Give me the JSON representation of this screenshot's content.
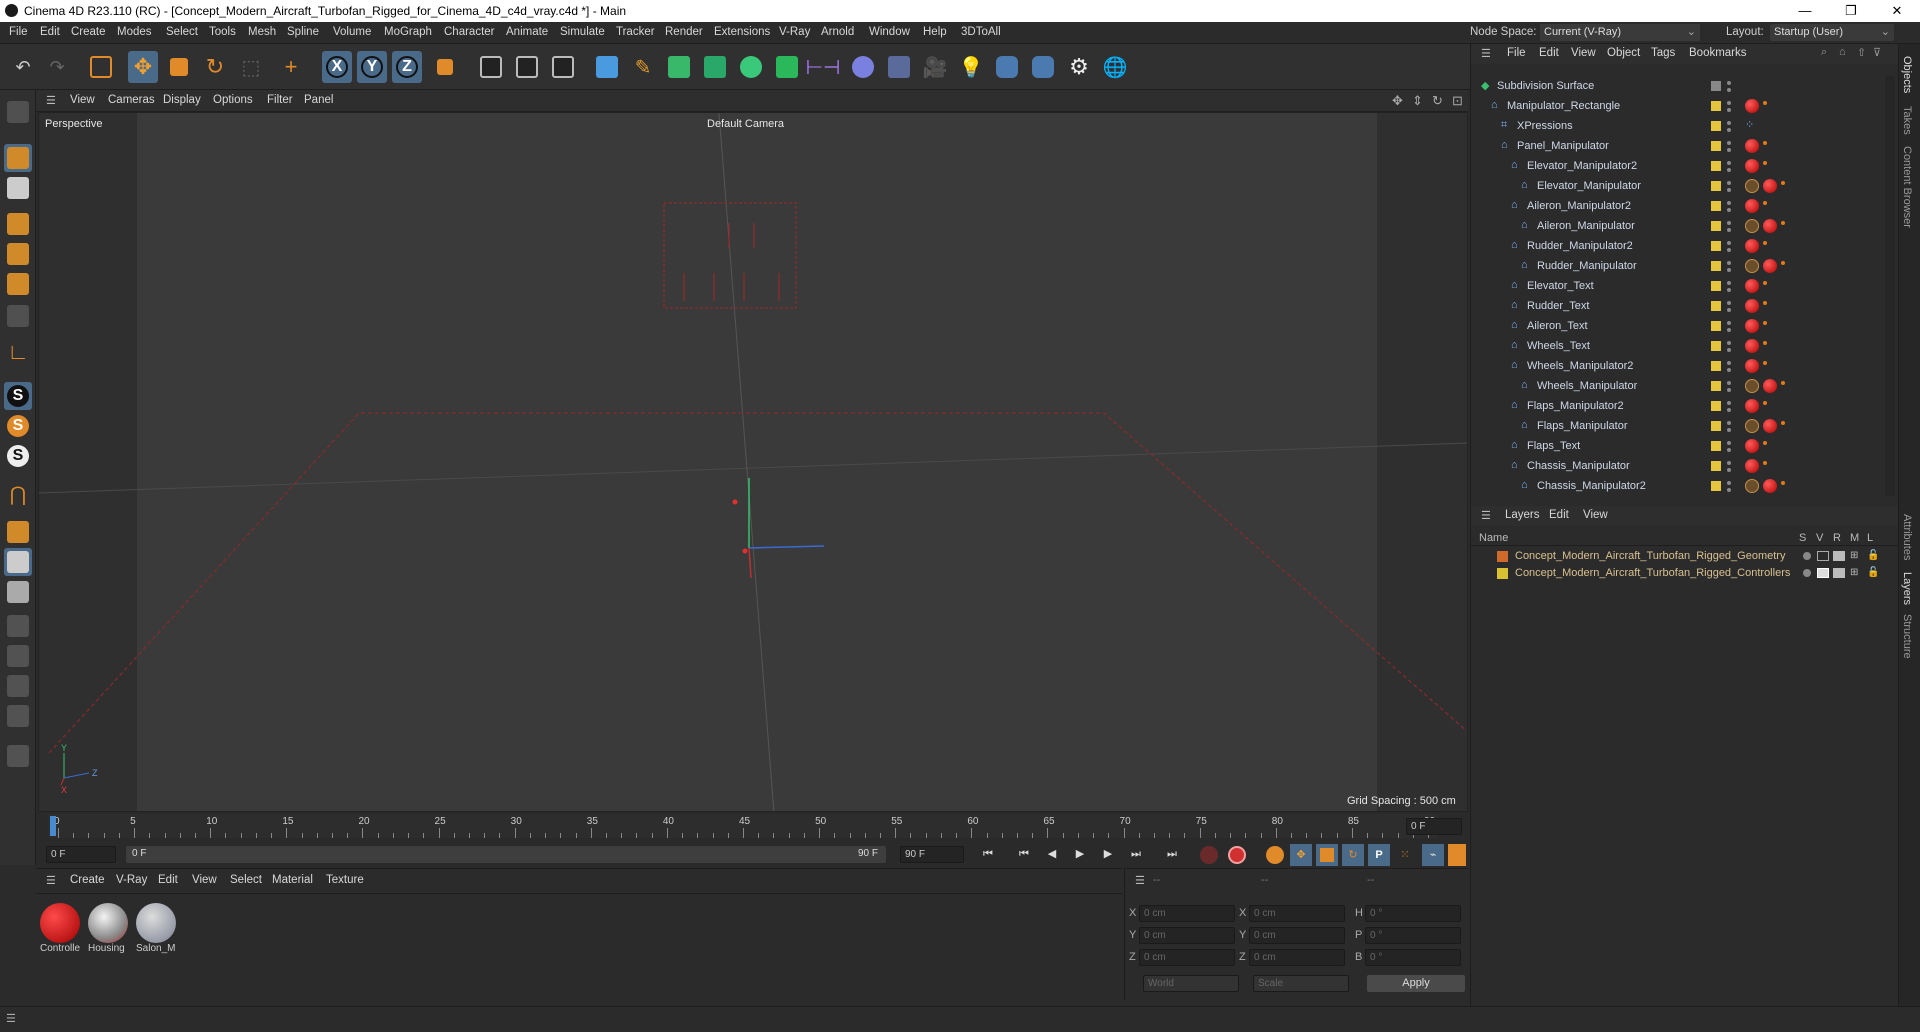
{
  "window": {
    "title": "Cinema 4D R23.110 (RC) - [Concept_Modern_Aircraft_Turbofan_Rigged_for_Cinema_4D_c4d_vray.c4d *] - Main",
    "min": "—",
    "max": "❐",
    "close": "✕"
  },
  "menu": [
    "File",
    "Edit",
    "Create",
    "Modes",
    "Select",
    "Tools",
    "Mesh",
    "Spline",
    "Volume",
    "MoGraph",
    "Character",
    "Animate",
    "Simulate",
    "Tracker",
    "Render",
    "Extensions",
    "V-Ray",
    "Arnold",
    "Window",
    "Help",
    "3DToAll"
  ],
  "nodespace": {
    "label": "Node Space:",
    "value": "Current (V-Ray)"
  },
  "layout": {
    "label": "Layout:",
    "value": "Startup (User)"
  },
  "viewport_menu": [
    "View",
    "Cameras",
    "Display",
    "Options",
    "Filter",
    "Panel"
  ],
  "viewport": {
    "name": "Perspective",
    "camera": "Default Camera",
    "grid_spacing": "Grid Spacing : 500 cm",
    "axis_y": "Y",
    "axis_z": "Z",
    "axis_x": "X"
  },
  "timeline": {
    "ticks": [
      "0",
      "5",
      "10",
      "15",
      "20",
      "25",
      "30",
      "35",
      "40",
      "45",
      "50",
      "55",
      "60",
      "65",
      "70",
      "75",
      "80",
      "85",
      "90"
    ],
    "current_frame_right": "0 F",
    "start_field": "0 F",
    "range_start": "0 F",
    "range_end": "90 F",
    "end_field": "90 F"
  },
  "materials": {
    "menu": [
      "Create",
      "V-Ray",
      "Edit",
      "View",
      "Select",
      "Material",
      "Texture"
    ],
    "items": [
      {
        "label": "Controlle"
      },
      {
        "label": "Housing"
      },
      {
        "label": "Salon_M"
      }
    ]
  },
  "coords": {
    "header": [
      "--",
      "--",
      "--"
    ],
    "rows": [
      {
        "a": "X",
        "av": "0 cm",
        "b": "X",
        "bv": "0 cm",
        "c": "H",
        "cv": "0 °"
      },
      {
        "a": "Y",
        "av": "0 cm",
        "b": "Y",
        "bv": "0 cm",
        "c": "P",
        "cv": "0 °"
      },
      {
        "a": "Z",
        "av": "0 cm",
        "b": "Z",
        "bv": "0 cm",
        "c": "B",
        "cv": "0 °"
      }
    ],
    "world": "World",
    "scale": "Scale",
    "apply": "Apply"
  },
  "objects": {
    "menu": [
      "File",
      "Edit",
      "View",
      "Object",
      "Tags",
      "Bookmarks"
    ],
    "items": [
      {
        "name": "Subdivision Surface",
        "depth": 0,
        "tags": "none"
      },
      {
        "name": "Manipulator_Rectangle",
        "depth": 1,
        "tags": "red"
      },
      {
        "name": "XPressions",
        "depth": 2,
        "tags": "xp"
      },
      {
        "name": "Panel_Manipulator",
        "depth": 2,
        "tags": "red"
      },
      {
        "name": "Elevator_Manipulator2",
        "depth": 3,
        "tags": "red"
      },
      {
        "name": "Elevator_Manipulator",
        "depth": 4,
        "tags": "slash"
      },
      {
        "name": "Aileron_Manipulator2",
        "depth": 3,
        "tags": "red"
      },
      {
        "name": "Aileron_Manipulator",
        "depth": 4,
        "tags": "slash"
      },
      {
        "name": "Rudder_Manipulator2",
        "depth": 3,
        "tags": "red"
      },
      {
        "name": "Rudder_Manipulator",
        "depth": 4,
        "tags": "slash"
      },
      {
        "name": "Elevator_Text",
        "depth": 3,
        "tags": "red"
      },
      {
        "name": "Rudder_Text",
        "depth": 3,
        "tags": "red"
      },
      {
        "name": "Aileron_Text",
        "depth": 3,
        "tags": "red"
      },
      {
        "name": "Wheels_Text",
        "depth": 3,
        "tags": "red"
      },
      {
        "name": "Wheels_Manipulator2",
        "depth": 3,
        "tags": "red"
      },
      {
        "name": "Wheels_Manipulator",
        "depth": 4,
        "tags": "slash"
      },
      {
        "name": "Flaps_Manipulator2",
        "depth": 3,
        "tags": "red"
      },
      {
        "name": "Flaps_Manipulator",
        "depth": 4,
        "tags": "slash"
      },
      {
        "name": "Flaps_Text",
        "depth": 3,
        "tags": "red"
      },
      {
        "name": "Chassis_Manipulator",
        "depth": 3,
        "tags": "red"
      },
      {
        "name": "Chassis_Manipulator2",
        "depth": 4,
        "tags": "slash"
      }
    ]
  },
  "layers": {
    "menu": [
      "Layers",
      "Edit",
      "View"
    ],
    "col_name": "Name",
    "cols": [
      "S",
      "V",
      "R",
      "M",
      "L"
    ],
    "items": [
      {
        "name": "Concept_Modern_Aircraft_Turbofan_Rigged_Geometry",
        "color": "#d06a2a"
      },
      {
        "name": "Concept_Modern_Aircraft_Turbofan_Rigged_Controllers",
        "color": "#d8c232"
      }
    ]
  },
  "right_tabs": [
    "Objects",
    "Takes",
    "Content Browser",
    "Attributes",
    "Layers",
    "Structure"
  ]
}
